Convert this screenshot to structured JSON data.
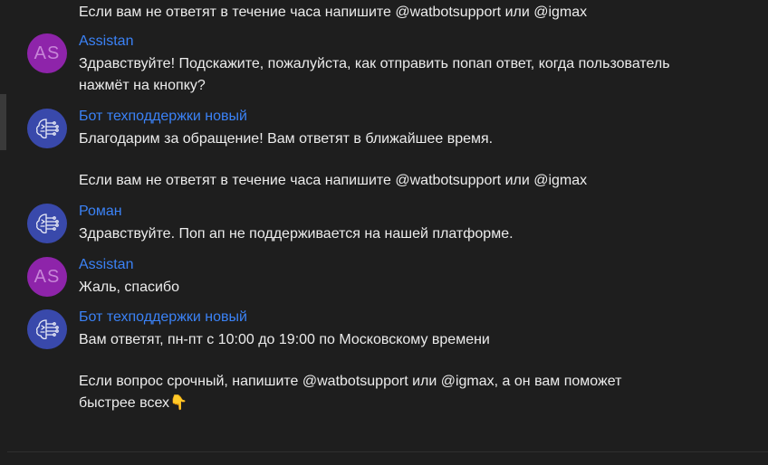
{
  "colors": {
    "background": "#1e1e1e",
    "author": "#3b82f6",
    "avatar_as": "#8e24aa",
    "avatar_bot": "#3949ab"
  },
  "top_line": "Если вам не ответят в течение часа напишите @watbotsupport или @igmax",
  "messages": [
    {
      "author": "Assistan",
      "avatar_text": "AS",
      "avatar_type": "initials",
      "paragraphs": [
        "Здравствуйте! Подскажите, пожалуйста, как отправить попап ответ, когда пользователь нажмёт на кнопку?"
      ]
    },
    {
      "author": "Бот техподдержки новый",
      "avatar_type": "bot-icon",
      "paragraphs": [
        "Благодарим за обращение! Вам ответят в ближайшее время.",
        "Если вам не ответят в течение часа напишите @watbotsupport или @igmax"
      ]
    },
    {
      "author": "Роман",
      "avatar_type": "bot-icon",
      "paragraphs": [
        "Здравствуйте. Поп ап не поддерживается на нашей платформе."
      ]
    },
    {
      "author": "Assistan",
      "avatar_text": "AS",
      "avatar_type": "initials",
      "paragraphs": [
        "Жаль, спасибо"
      ]
    },
    {
      "author": "Бот техподдержки новый",
      "avatar_type": "bot-icon",
      "paragraphs": [
        "Вам ответят, пн-пт с 10:00 до 19:00 по Московскому времени",
        "Если вопрос срочный, напишите @watbotsupport или @igmax, а он вам поможет быстрее всех👇"
      ]
    }
  ]
}
